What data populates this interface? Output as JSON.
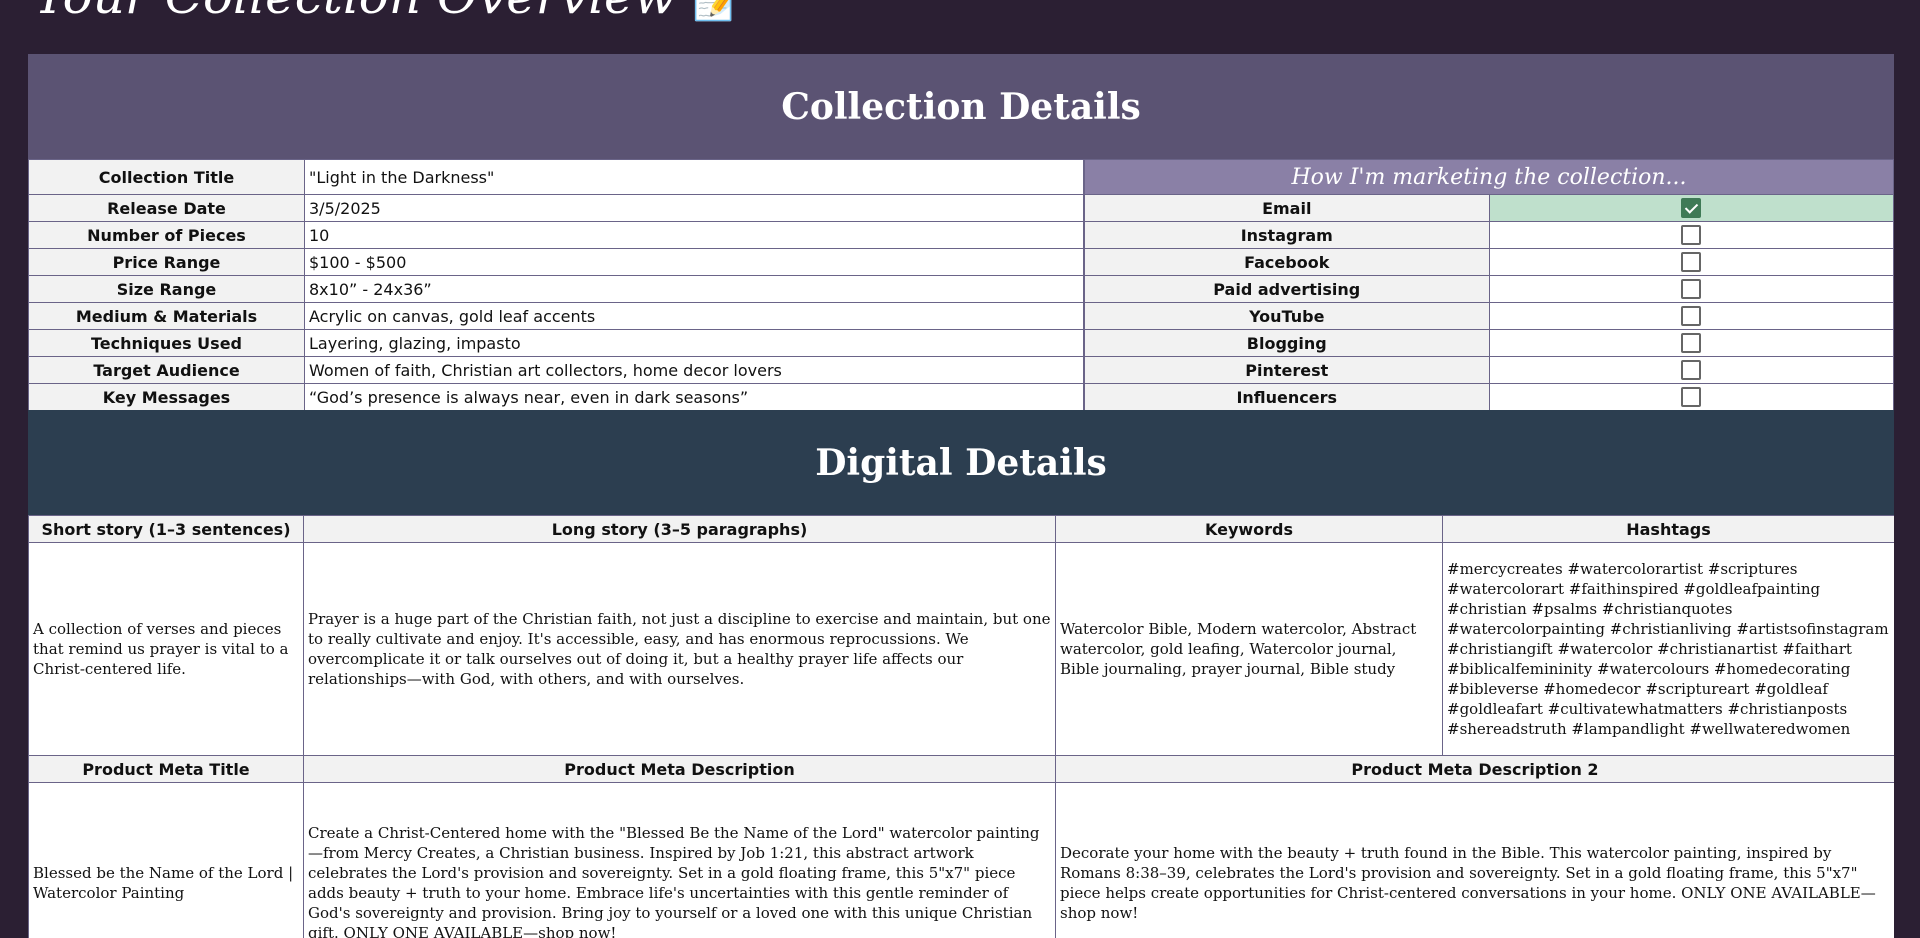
{
  "page_title": "Your Collection Overview",
  "page_title_emoji": "📝",
  "collection_section": {
    "heading": "Collection Details",
    "rows": [
      {
        "label": "Collection Title",
        "value": "\"Light in the Darkness\""
      },
      {
        "label": "Release Date",
        "value": "3/5/2025"
      },
      {
        "label": "Number of Pieces",
        "value": "10"
      },
      {
        "label": "Price Range",
        "value": "$100 - $500"
      },
      {
        "label": "Size Range",
        "value": "8x10” - 24x36”"
      },
      {
        "label": "Medium & Materials",
        "value": "Acrylic on canvas, gold leaf accents"
      },
      {
        "label": "Techniques Used",
        "value": "Layering, glazing, impasto"
      },
      {
        "label": "Target Audience",
        "value": "Women of faith, Christian art collectors, home decor lovers"
      },
      {
        "label": "Key Messages",
        "value": "“God’s presence is always near, even in dark seasons”"
      }
    ]
  },
  "marketing": {
    "heading": "How I'm marketing the collection...",
    "channels": [
      {
        "label": "Email",
        "checked": true
      },
      {
        "label": "Instagram",
        "checked": false
      },
      {
        "label": "Facebook",
        "checked": false
      },
      {
        "label": "Paid advertising",
        "checked": false
      },
      {
        "label": "YouTube",
        "checked": false
      },
      {
        "label": "Blogging",
        "checked": false
      },
      {
        "label": "Pinterest",
        "checked": false
      },
      {
        "label": "Influencers",
        "checked": false
      }
    ],
    "checked_color": "#bfe0cc"
  },
  "digital_section": {
    "heading": "Digital Details",
    "headers": [
      "Short story (1–3 sentences)",
      "Long story (3–5 paragraphs)",
      "Keywords",
      "Hashtags"
    ],
    "short_story": "A collection of verses and pieces that remind us prayer is vital to a Christ-centered life.",
    "long_story": " Prayer is a huge part of the Christian faith, not just a discipline to exercise and maintain, but one to really cultivate and enjoy. It's accessible, easy, and has enormous reprocussions. We overcomplicate it or talk ourselves out of doing it, but a healthy prayer life affects our relationships—with God, with others, and with ourselves.",
    "keywords": "Watercolor Bible, Modern watercolor, Abstract watercolor, gold leafing, Watercolor journal, Bible journaling, prayer journal, Bible study",
    "hashtags": "#mercycreates #watercolorartist #scriptures #watercolorart #faithinspired #goldleafpainting #christian #psalms #christianquotes #watercolorpainting #christianliving #artistsofinstagram #christiangift #watercolor #christianartist #faithart #biblicalfemininity #watercolours #homedecorating #bibleverse #homedecor #scriptureart #goldleaf #goldleafart #cultivatewhatmatters #christianposts #shereadstruth #lampandlight #wellwateredwomen",
    "meta_headers": [
      "Product Meta Title",
      "Product Meta Description",
      "Product Meta Description 2"
    ],
    "meta_title": "Blessed be the Name of the Lord | Watercolor Painting",
    "meta_description": "Create a Christ-Centered home with the \"Blessed Be the Name of the Lord\" watercolor painting—from Mercy Creates, a Christian business. Inspired by Job 1:21, this abstract artwork celebrates the Lord's provision and sovereignty. Set in a gold floating frame, this 5\"x7\" piece adds beauty + truth to your home. Embrace life's uncertainties with this gentle reminder of God's sovereignty and provision. Bring joy to yourself or a loved one with this unique Christian gift. ONLY ONE AVAILABLE—shop now!",
    "meta_description_2": "Decorate your home with the beauty + truth found in the Bible. This watercolor painting, inspired by Romans 8:38–39, celebrates the Lord's provision and sovereignty. Set in a gold floating frame, this 5\"x7\" piece helps create opportunities for Christ-centered conversations in your home. ONLY ONE AVAILABLE—shop now!"
  }
}
